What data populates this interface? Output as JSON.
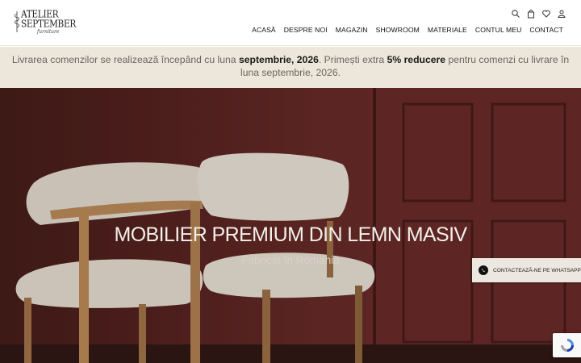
{
  "header": {
    "logo": {
      "line1": "ATELIER",
      "line2": "SEPTEMBER",
      "sub": "furniture"
    },
    "icons": [
      "search-icon",
      "bag-icon",
      "heart-icon",
      "user-icon"
    ],
    "nav": [
      "ACASĂ",
      "DESPRE NOI",
      "MAGAZIN",
      "SHOWROOM",
      "MATERIALE",
      "CONTUL MEU",
      "CONTACT"
    ]
  },
  "banner": {
    "t1": "Livrarea comenzilor se realizează începând cu luna ",
    "b1": "septembrie, 2026",
    "t2": ". Primești extra ",
    "b2": "5% reducere",
    "t3": " pentru comenzi cu livrare în luna septembrie, 2026."
  },
  "hero": {
    "title": "MOBILIER PREMIUM DIN LEMN MASIV",
    "subtitle": "Fabricat în Romania"
  },
  "whatsapp": {
    "label": "CONTACTEAZĂ-NE PE WHATSAPP"
  },
  "colors": {
    "banner_bg": "#ede6da",
    "hero_wall": "#5a2522",
    "accent": "#1a1a1a"
  }
}
